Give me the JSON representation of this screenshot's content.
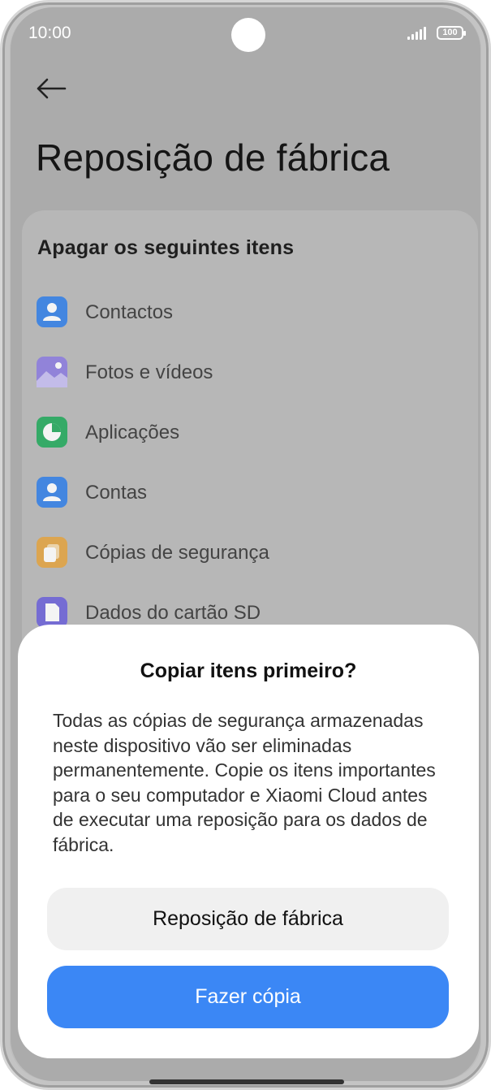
{
  "status_bar": {
    "time": "10:00",
    "battery": "100"
  },
  "page": {
    "title": "Reposição de fábrica"
  },
  "section": {
    "title": "Apagar os seguintes itens",
    "items": [
      {
        "label": "Contactos",
        "icon": "contact-icon",
        "color": "#2f7ee8"
      },
      {
        "label": "Fotos e vídeos",
        "icon": "gallery-icon",
        "color": "#8b7ae0"
      },
      {
        "label": "Aplicações",
        "icon": "apps-pie-icon",
        "color": "#1fa85a"
      },
      {
        "label": "Contas",
        "icon": "account-icon",
        "color": "#2f7ee8"
      },
      {
        "label": "Cópias de segurança",
        "icon": "backup-icon",
        "color": "#e3a33f"
      },
      {
        "label": "Dados do cartão SD",
        "icon": "sd-card-icon",
        "color": "#6a5fd8"
      }
    ]
  },
  "dialog": {
    "title": "Copiar itens primeiro?",
    "body": "Todas as cópias de segurança armazenadas neste dispositivo vão ser eliminadas permanentemente. Copie os itens importantes para o seu computador e Xiaomi Cloud antes de executar uma reposição para os dados de fábrica.",
    "reset_button": "Reposição de fábrica",
    "copy_button": "Fazer cópia"
  },
  "colors": {
    "primary": "#3b87f5",
    "scrim": "#ababab",
    "sheet": "#ffffff"
  }
}
